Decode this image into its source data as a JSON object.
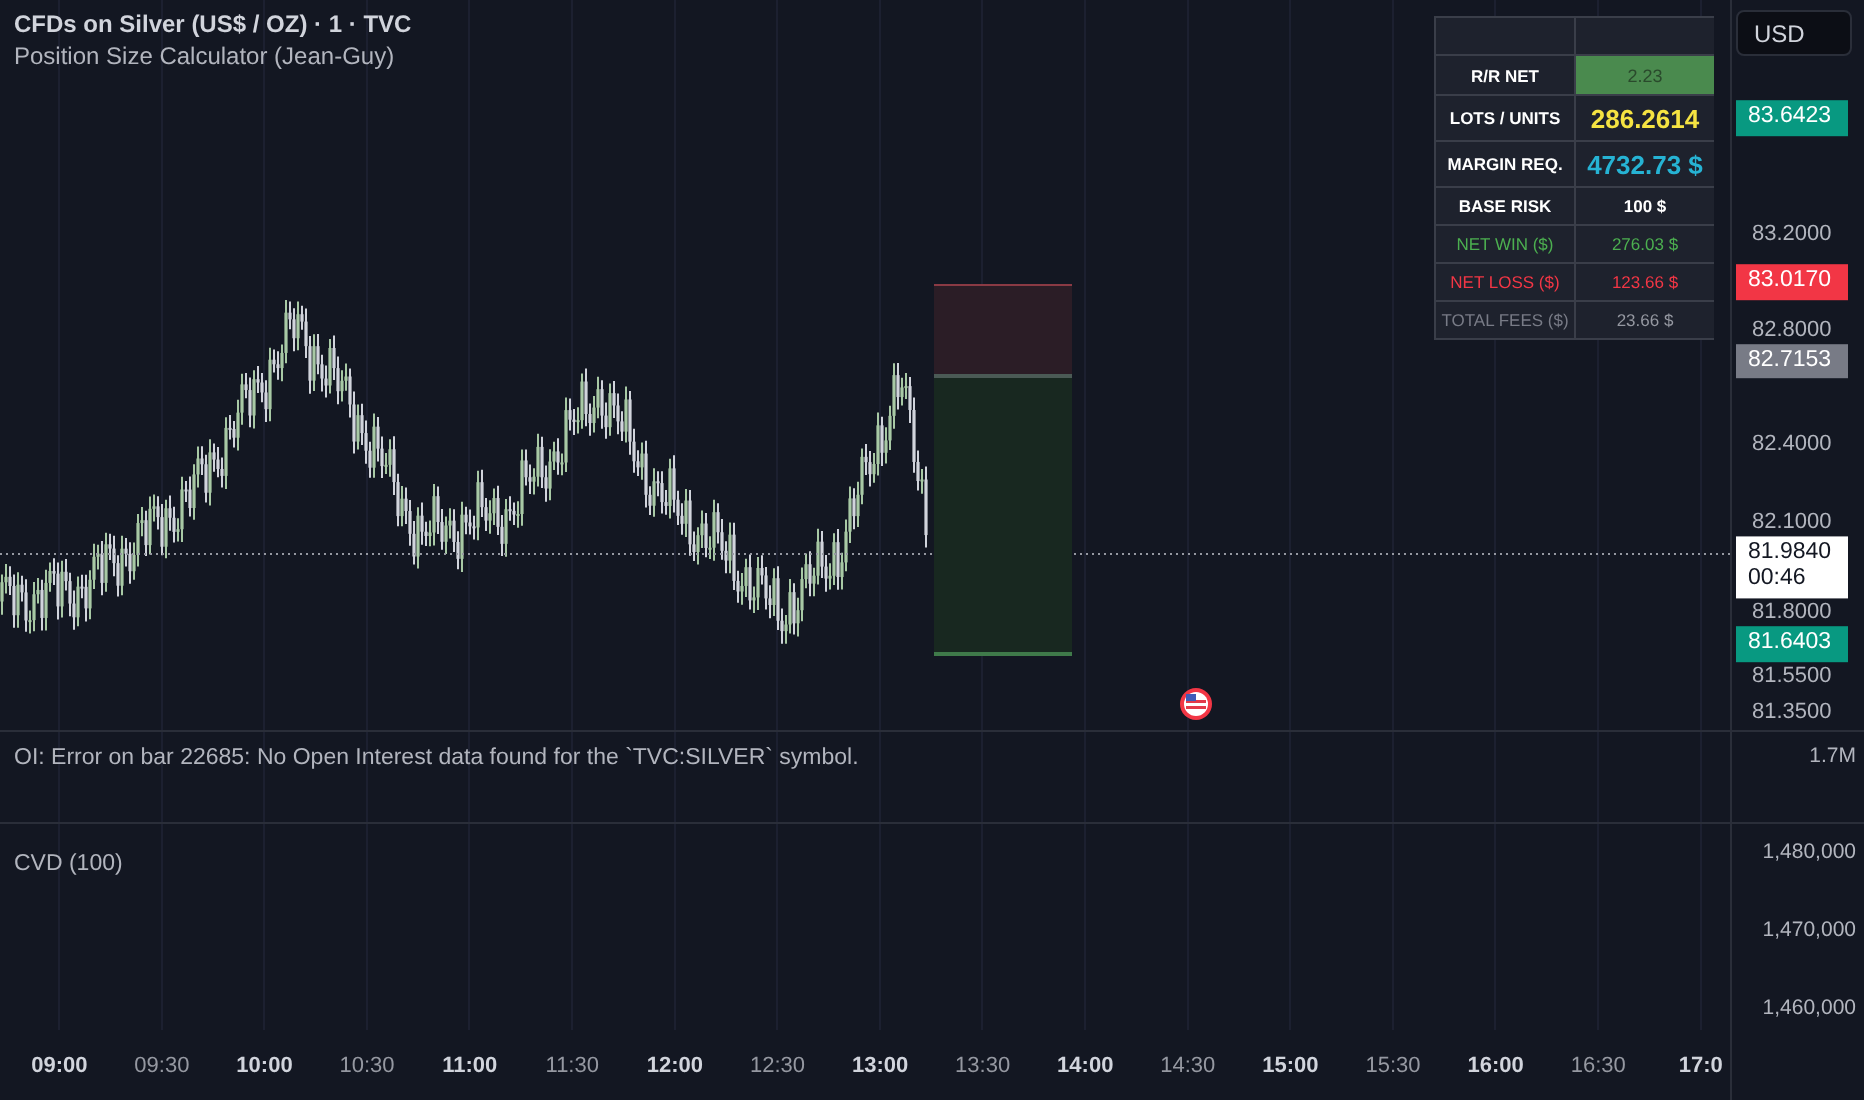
{
  "header": {
    "title": "CFDs on Silver (US$ / OZ) · 1 · TVC",
    "indicator": "Position Size Calculator (Jean-Guy)"
  },
  "currency_button": "USD",
  "calc_table": {
    "rows": [
      {
        "kind": "highlight",
        "label": {
          "text": "R/R NET",
          "color": "#ffffff"
        },
        "value": {
          "text": "2.23",
          "color": "#4a8a4e"
        }
      },
      {
        "kind": "large",
        "label": {
          "text": "LOTS / UNITS",
          "color": "#ffffff"
        },
        "value": {
          "text": "286.2614",
          "color": "#f5e342"
        }
      },
      {
        "kind": "large",
        "label": {
          "text": "MARGIN REQ.",
          "color": "#ffffff"
        },
        "value": {
          "text": "4732.73 $",
          "color": "#26b3d4"
        }
      },
      {
        "kind": "plain",
        "label": {
          "text": "BASE RISK",
          "color": "#ffffff"
        },
        "value": {
          "text": "100 $",
          "color": "#ffffff"
        }
      },
      {
        "kind": "plain",
        "label": {
          "text": "NET WIN ($)",
          "color": "#4caf50"
        },
        "value": {
          "text": "276.03 $",
          "color": "#4caf50"
        }
      },
      {
        "kind": "plain",
        "label": {
          "text": "NET LOSS ($)",
          "color": "#f23645"
        },
        "value": {
          "text": "123.66 $",
          "color": "#f23645"
        }
      },
      {
        "kind": "plain",
        "label": {
          "text": "TOTAL FEES ($)",
          "color": "#787b86"
        },
        "value": {
          "text": "23.66 $",
          "color": "#9598a1"
        }
      }
    ]
  },
  "price_axis": {
    "ticks": [
      "83.2000",
      "82.8000",
      "82.4000",
      "82.1000",
      "81.8000",
      "81.5500",
      "81.3500"
    ],
    "tags": [
      {
        "label": "83.6423",
        "color": "#089981"
      },
      {
        "label": "83.0170",
        "color": "#f23645"
      },
      {
        "label": "82.7153",
        "color": "#787b86"
      },
      {
        "label": "81.9840",
        "sub": "00:46",
        "color": "#ffffff"
      },
      {
        "label": "81.6403",
        "color": "#089981"
      }
    ]
  },
  "oi_pane": {
    "message": "OI: Error on bar 22685: No Open Interest data found for the `TVC:SILVER` symbol.",
    "axis": [
      "1.7M"
    ]
  },
  "cvd_pane": {
    "title": "CVD (100)",
    "axis": [
      "1,480,000",
      "1,470,000",
      "1,460,000"
    ]
  },
  "time_axis": [
    {
      "label": "09:00",
      "major": true
    },
    {
      "label": "09:30",
      "major": false
    },
    {
      "label": "10:00",
      "major": true
    },
    {
      "label": "10:30",
      "major": false
    },
    {
      "label": "11:00",
      "major": true
    },
    {
      "label": "11:30",
      "major": false
    },
    {
      "label": "12:00",
      "major": true
    },
    {
      "label": "12:30",
      "major": false
    },
    {
      "label": "13:00",
      "major": true
    },
    {
      "label": "13:30",
      "major": false
    },
    {
      "label": "14:00",
      "major": true
    },
    {
      "label": "14:30",
      "major": false
    },
    {
      "label": "15:00",
      "major": true
    },
    {
      "label": "15:30",
      "major": false
    },
    {
      "label": "16:00",
      "major": true
    },
    {
      "label": "16:30",
      "major": false
    },
    {
      "label": "17:0",
      "major": true
    }
  ]
}
